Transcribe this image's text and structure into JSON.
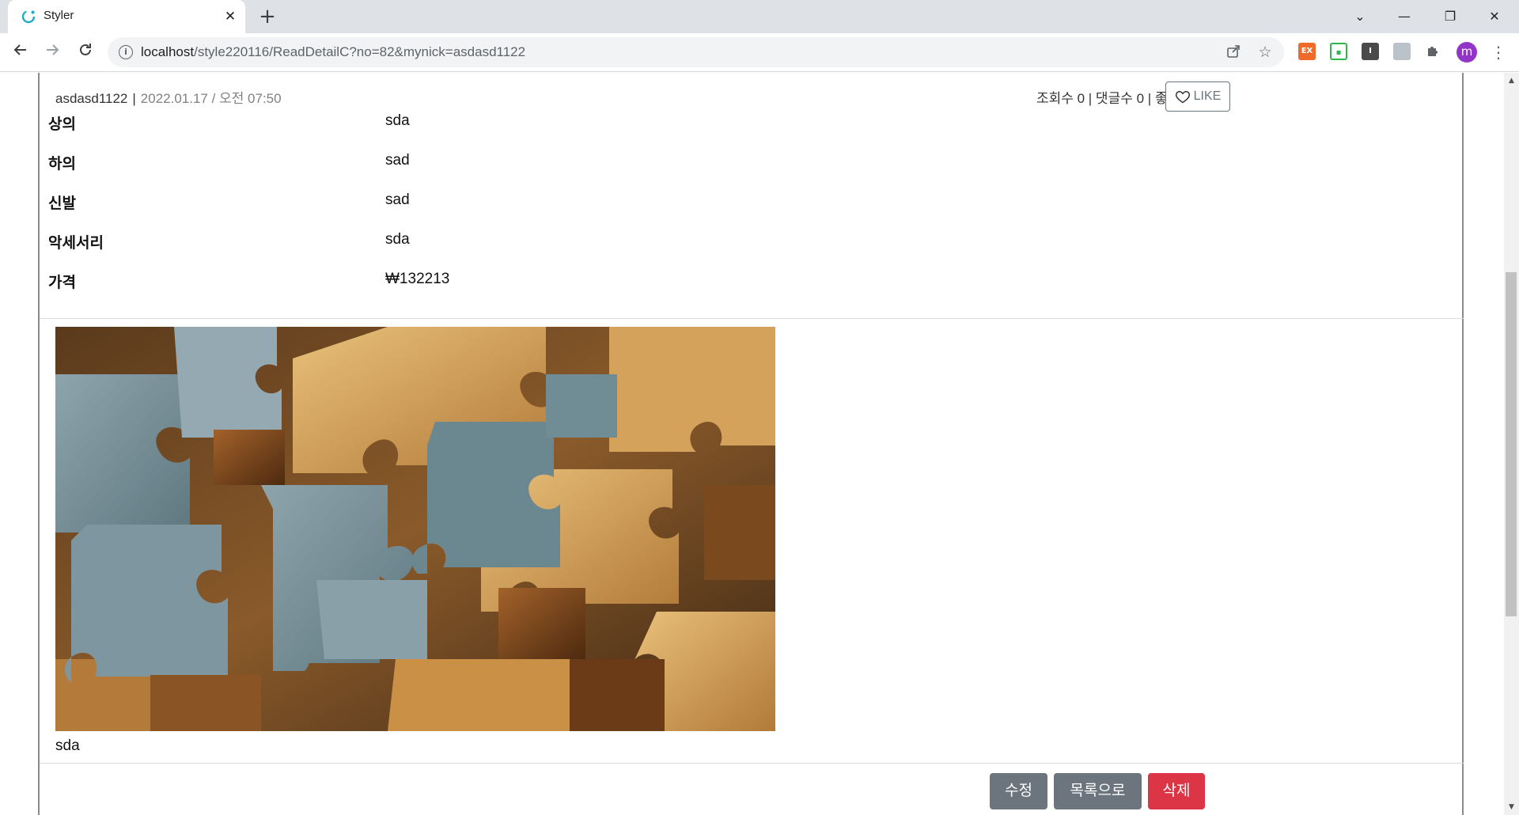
{
  "browser": {
    "tab_title": "Styler",
    "tab_close": "✕",
    "new_tab": "+",
    "url_host": "localhost",
    "url_path": "/style220116/ReadDetailC?no=82&mynick=asdasd1122",
    "profile_initial": "m",
    "ext_labels": {
      "ex": "EX",
      "green": "▪",
      "dark": "I"
    },
    "window_controls": {
      "dropdown": "⌄",
      "minimize": "—",
      "restore": "❐",
      "close": "✕"
    }
  },
  "post": {
    "author": "asdasd1122",
    "separator": "|",
    "date": "2022.01.17 / 오전 07:50",
    "stats": "조회수 0 | 댓글수 0 | 좋아요 0",
    "like_label": "LIKE"
  },
  "details": [
    {
      "label": "상의",
      "value": "sda"
    },
    {
      "label": "하의",
      "value": "sad"
    },
    {
      "label": "신발",
      "value": "sad"
    },
    {
      "label": "악세서리",
      "value": "sda"
    },
    {
      "label": "가격",
      "value": "₩132213"
    }
  ],
  "content": {
    "caption": "sda"
  },
  "actions": {
    "edit": "수정",
    "list": "목록으로",
    "delete": "삭제"
  },
  "colors": {
    "accent_gray": "#6c757d",
    "danger_red": "#dc3545",
    "profile_purple": "#9334c9"
  }
}
